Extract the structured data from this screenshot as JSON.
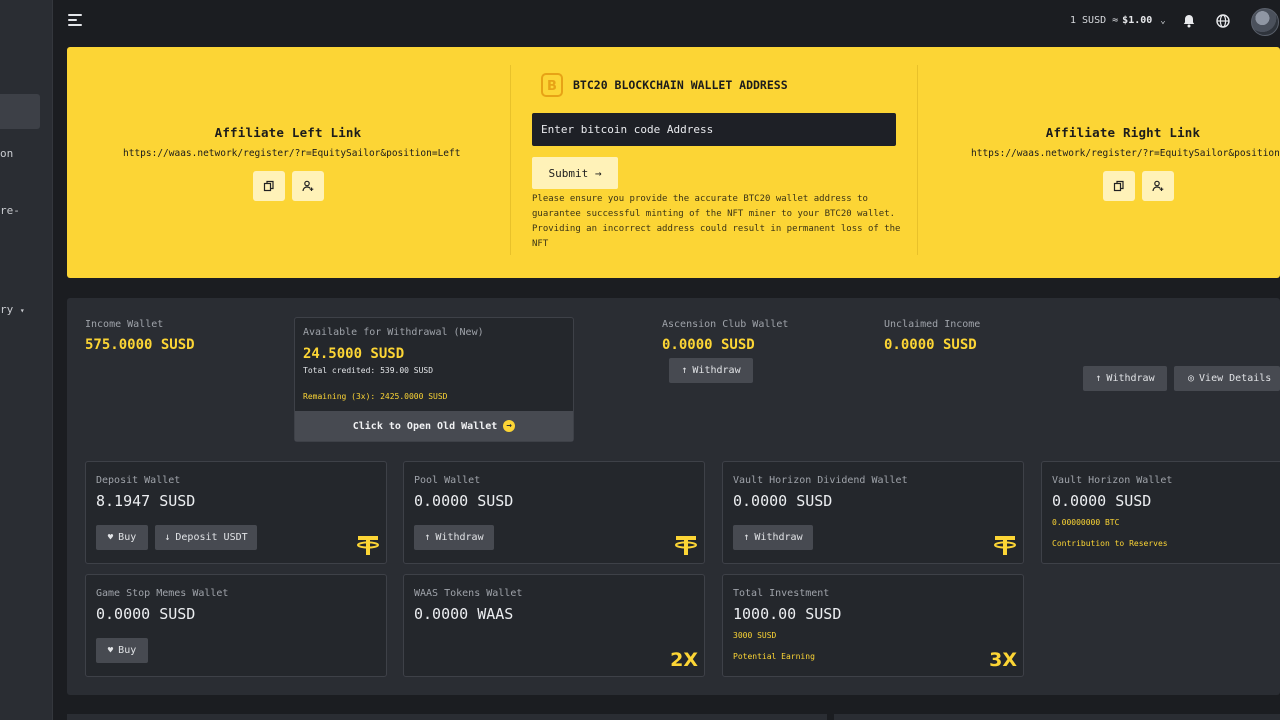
{
  "sidebar": {
    "items": [
      "on",
      "re-",
      "ry"
    ]
  },
  "header": {
    "rate_prefix": "1 SUSD ≈",
    "rate_value": "$1.00"
  },
  "banner": {
    "affiliate_left": {
      "title": "Affiliate Left Link",
      "link": "https://waas.network/register/?r=EquitySailor&position=Left"
    },
    "affiliate_right": {
      "title": "Affiliate Right Link",
      "link": "https://waas.network/register/?r=EquitySailor&position=Right"
    },
    "btc": {
      "title": "BTC20 BLOCKCHAIN WALLET ADDRESS",
      "placeholder": "Enter bitcoin code Address",
      "submit_label": "Submit →",
      "note": "Please ensure you provide the accurate BTC20 wallet address to guarantee successful minting of the NFT miner to your BTC20 wallet. Providing an incorrect address could result in permanent loss of the NFT"
    }
  },
  "wallets": {
    "income": {
      "label": "Income Wallet",
      "value": "575.0000 SUSD"
    },
    "available": {
      "label": "Available for Withdrawal (New)",
      "value": "24.5000 SUSD",
      "credited": "Total credited: 539.00 SUSD",
      "remaining": "Remaining (3x): 2425.0000 SUSD",
      "open_old": "Click to Open Old Wallet"
    },
    "ascension": {
      "label": "Ascension Club Wallet",
      "value": "0.0000 SUSD",
      "withdraw": "Withdraw"
    },
    "unclaimed": {
      "label": "Unclaimed Income",
      "value": "0.0000 SUSD"
    },
    "main_withdraw": "Withdraw",
    "view_details": "View Details",
    "deposit": {
      "label": "Deposit Wallet",
      "value": "8.1947 SUSD",
      "buy": "Buy",
      "deposit_btn": "Deposit USDT"
    },
    "pool": {
      "label": "Pool Wallet",
      "value": "0.0000 SUSD",
      "withdraw": "Withdraw"
    },
    "vault_dividend": {
      "label": "Vault Horizon Dividend Wallet",
      "value": "0.0000 SUSD",
      "withdraw": "Withdraw"
    },
    "vault_horizon": {
      "label": "Vault Horizon Wallet",
      "value": "0.0000 SUSD",
      "btc": "0.00000000 BTC",
      "note": "Contribution to Reserves"
    },
    "gamestop": {
      "label": "Game Stop Memes Wallet",
      "value": "0.0000 SUSD",
      "buy": "Buy"
    },
    "waas": {
      "label": "WAAS Tokens Wallet",
      "value": "0.0000 WAAS",
      "mult": "2X"
    },
    "investment": {
      "label": "Total Investment",
      "value": "1000.00 SUSD",
      "amount": "3000 SUSD",
      "potential": "Potential Earning",
      "mult": "3X"
    }
  },
  "colors": {
    "accent": "#fcd535",
    "bg": "#1b1d21",
    "panel": "#2a2d33"
  }
}
